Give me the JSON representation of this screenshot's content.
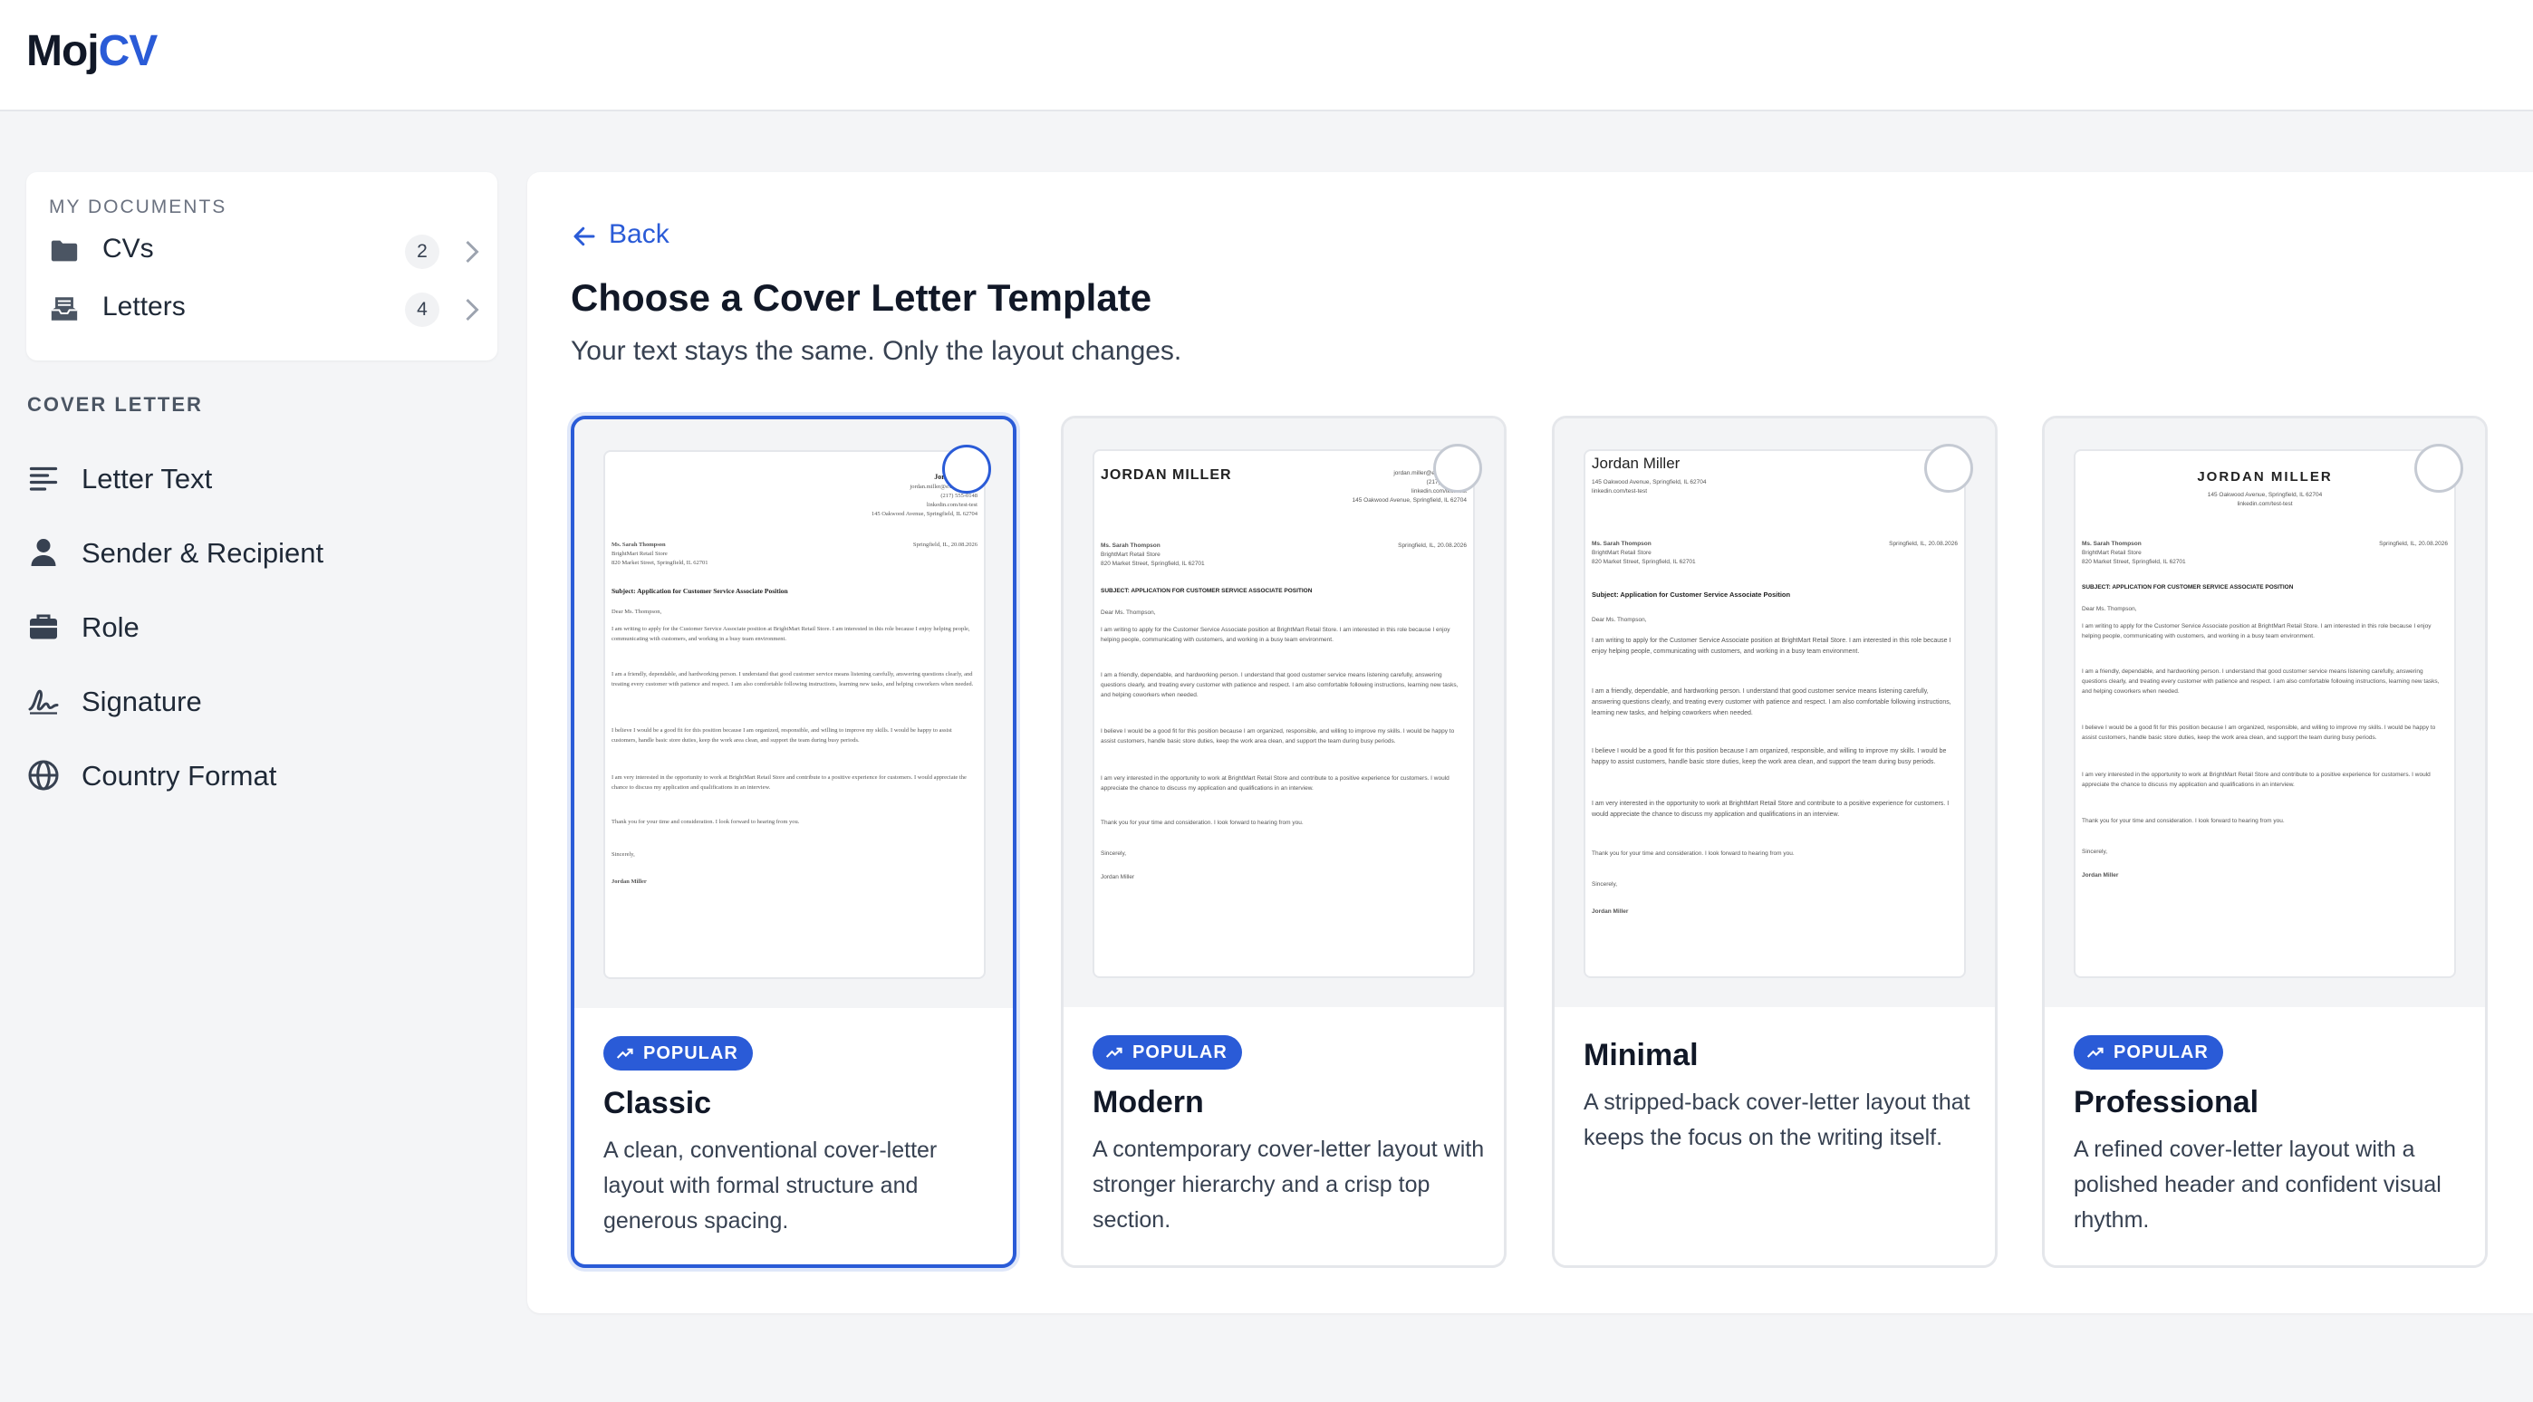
{
  "brand": {
    "part1": "Moj",
    "part2": "CV"
  },
  "sidebar": {
    "documents_label": "MY DOCUMENTS",
    "documents": [
      {
        "label": "CVs",
        "count": "2"
      },
      {
        "label": "Letters",
        "count": "4"
      }
    ],
    "section_label": "COVER LETTER",
    "nav": [
      {
        "label": "Letter Text"
      },
      {
        "label": "Sender & Recipient"
      },
      {
        "label": "Role"
      },
      {
        "label": "Signature"
      },
      {
        "label": "Country Format"
      }
    ]
  },
  "main": {
    "back_label": "Back",
    "title": "Choose a Cover Letter Template",
    "subtitle": "Your text stays the same. Only the layout changes.",
    "badge_label": "POPULAR",
    "templates": [
      {
        "name": "Classic",
        "popular": true,
        "selected": true,
        "description": "A clean, conventional cover-letter layout with formal structure and generous spacing."
      },
      {
        "name": "Modern",
        "popular": true,
        "selected": false,
        "description": "A contemporary cover-letter layout with stronger hierarchy and a crisp top section."
      },
      {
        "name": "Minimal",
        "popular": false,
        "selected": false,
        "description": "A stripped-back cover-letter layout that keeps the focus on the writing itself."
      },
      {
        "name": "Professional",
        "popular": true,
        "selected": false,
        "description": "A refined cover-letter layout with a polished header and confident visual rhythm."
      }
    ]
  },
  "letter": {
    "sender_name": "Jordan Miller",
    "sender_name_caps": "JORDAN MILLER",
    "email": "jordan.miller@example.com",
    "phone": "(217) 555-0148",
    "linkedin": "linkedin.com/test-test",
    "address": "145 Oakwood Avenue, Springfield, IL 62704",
    "recipient_name": "Ms. Sarah Thompson",
    "company": "BrightMart Retail Store",
    "company_address": "820 Market Street, Springfield, IL 62701",
    "date_classic": "Springfield, IL, 20.08.2026",
    "subject": "Subject: Application for Customer Service Associate Position",
    "subject_caps": "SUBJECT: APPLICATION FOR CUSTOMER SERVICE ASSOCIATE POSITION",
    "greeting": "Dear Ms. Thompson,",
    "p1": "I am writing to apply for the Customer Service Associate position at BrightMart Retail Store. I am interested in this role because I enjoy helping people, communicating with customers, and working in a busy team environment.",
    "p2": "I am a friendly, dependable, and hardworking person. I understand that good customer service means listening carefully, answering questions clearly, and treating every customer with patience and respect. I am also comfortable following instructions, learning new tasks, and helping coworkers when needed.",
    "p3": "I believe I would be a good fit for this position because I am organized, responsible, and willing to improve my skills. I would be happy to assist customers, handle basic store duties, keep the work area clean, and support the team during busy periods.",
    "p4": "I am very interested in the opportunity to work at BrightMart Retail Store and contribute to a positive experience for customers. I would appreciate the chance to discuss my application and qualifications in an interview.",
    "p5": "Thank you for your time and consideration. I look forward to hearing from you.",
    "closing": "Sincerely,"
  }
}
